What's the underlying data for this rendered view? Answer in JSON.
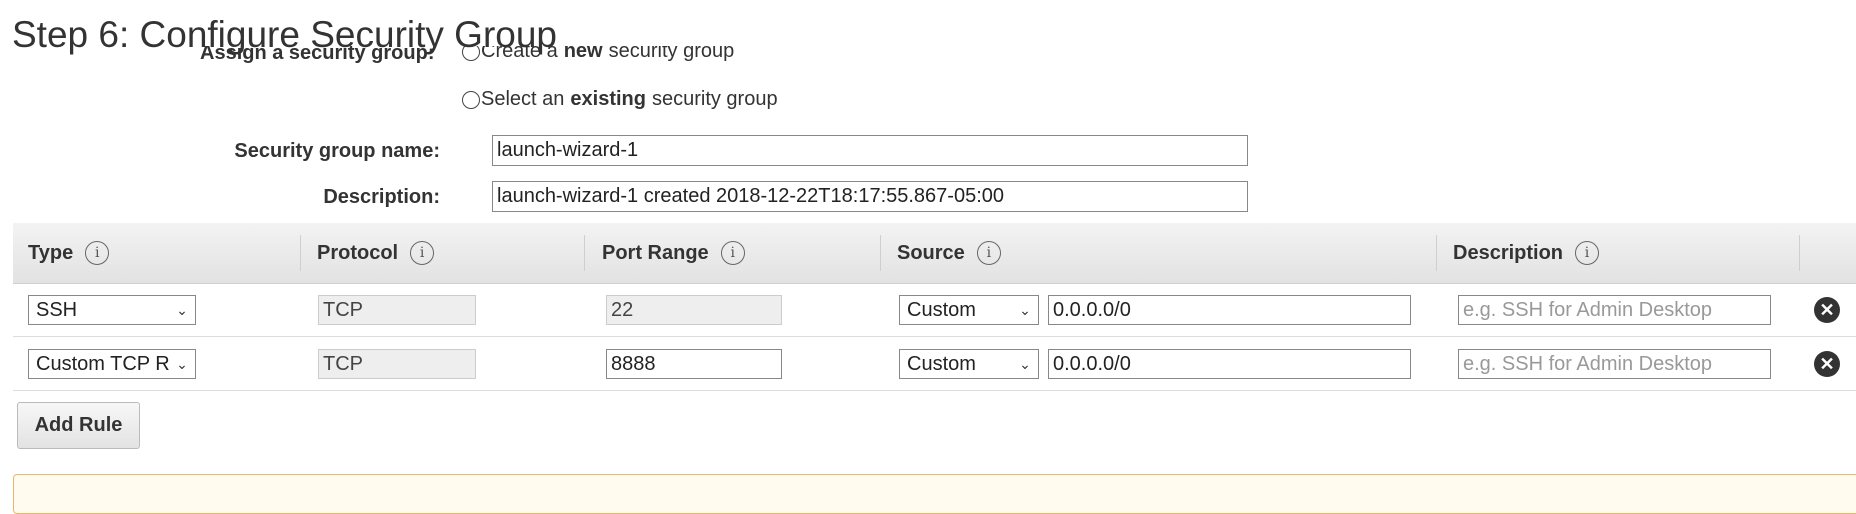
{
  "page": {
    "title": "Step 6: Configure Security Group"
  },
  "assign": {
    "label": "Assign a security group:",
    "create_prefix": "Create a",
    "create_bold": "new",
    "create_suffix": "security group",
    "existing_prefix": "Select an",
    "existing_bold": "existing",
    "existing_suffix": "security group",
    "selected": "create"
  },
  "form": {
    "name_label": "Security group name:",
    "name_value": "launch-wizard-1",
    "description_label": "Description:",
    "description_value": "launch-wizard-1 created 2018-12-22T18:17:55.867-05:00"
  },
  "table": {
    "headers": {
      "type": "Type",
      "protocol": "Protocol",
      "port_range": "Port Range",
      "source": "Source",
      "description": "Description"
    },
    "rows": [
      {
        "type": "SSH",
        "protocol": "TCP",
        "port_range": "22",
        "source_type": "Custom",
        "source_cidr": "0.0.0.0/0",
        "description_placeholder": "e.g. SSH for Admin Desktop"
      },
      {
        "type": "Custom TCP R",
        "protocol": "TCP",
        "port_range": "8888",
        "source_type": "Custom",
        "source_cidr": "0.0.0.0/0",
        "description_placeholder": "e.g. SSH for Admin Desktop"
      }
    ]
  },
  "buttons": {
    "add_rule": "Add Rule"
  },
  "icons": {
    "info": "info-icon",
    "remove": "remove-circle-icon",
    "dropdown": "chevron-down-icon"
  },
  "colors": {
    "header_bg": "#e9e9e9",
    "warning_border": "#e8b869",
    "warning_bg": "#fffbee"
  }
}
